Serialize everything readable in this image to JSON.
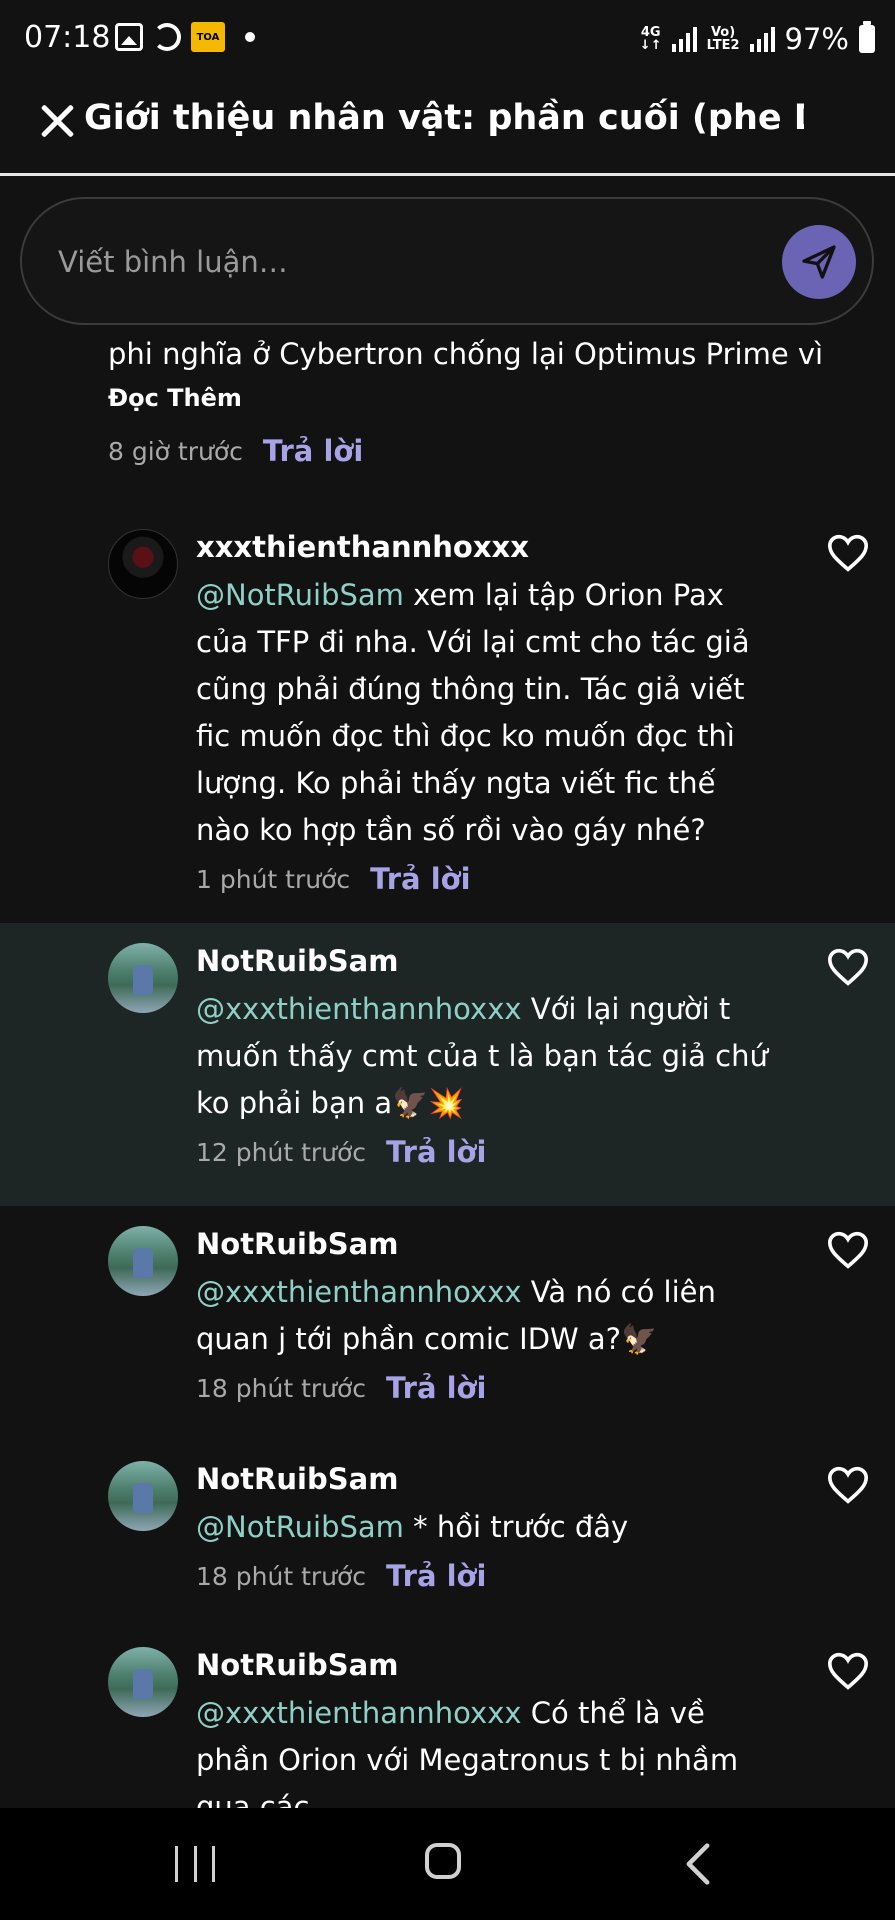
{
  "status_bar": {
    "time": "07:18",
    "badge": "TOA",
    "network_top": "4G",
    "volte_top": "Vo)",
    "volte_bottom": "LTE2",
    "battery": "97%"
  },
  "header": {
    "title": "Giới thiệu nhân vật: phần cuối (phe D..."
  },
  "comment_input": {
    "placeholder": "Viết bình luận…"
  },
  "partial_comment": {
    "text": "phi nghĩa ở Cybertron chống lại Optimus Prime vì",
    "read_more": "Đọc Thêm",
    "time": "8 giờ trước",
    "reply": "Trả lời"
  },
  "comments": [
    {
      "user": "xxxthienthannhoxxx",
      "mention": "@NotRuibSam",
      "text": " xem lại tập Orion Pax của TFP đi nha. Với lại cmt cho tác giả cũng phải đúng thông tin. Tác giả viết fic muốn đọc thì đọc ko muốn đọc thì lượng. Ko phải thấy ngta viết fic thế nào ko hợp tần số rồi vào gáy nhé?",
      "time": "1 phút trước",
      "reply": "Trả lời"
    },
    {
      "user": "NotRuibSam",
      "mention": "@xxxthienthannhoxxx",
      "text": " Với lại người t muốn thấy cmt của t là bạn tác giả chứ ko phải bạn a🦅💥",
      "time": "12 phút trước",
      "reply": "Trả lời"
    },
    {
      "user": "NotRuibSam",
      "mention": "@xxxthienthannhoxxx",
      "text": " Và nó có liên quan j tới phần comic IDW a?🦅",
      "time": "18 phút trước",
      "reply": "Trả lời"
    },
    {
      "user": "NotRuibSam",
      "mention": "@NotRuibSam",
      "text": " * hồi trước đây",
      "time": "18 phút trước",
      "reply": "Trả lời"
    },
    {
      "user": "NotRuibSam",
      "mention": "@xxxthienthannhoxxx",
      "text": " Có thể là về phần Orion với Megatronus t bị nhầm qua các",
      "time": "",
      "reply": ""
    }
  ],
  "colors": {
    "background": "#121212",
    "accent": "#a8a2e6",
    "send_button": "#6b64b5",
    "mention": "#8fd0c6",
    "highlight_row": "#1d2624"
  },
  "icons": [
    "close-icon",
    "send-icon",
    "heart-icon",
    "recent-apps-icon",
    "home-icon",
    "back-icon"
  ]
}
